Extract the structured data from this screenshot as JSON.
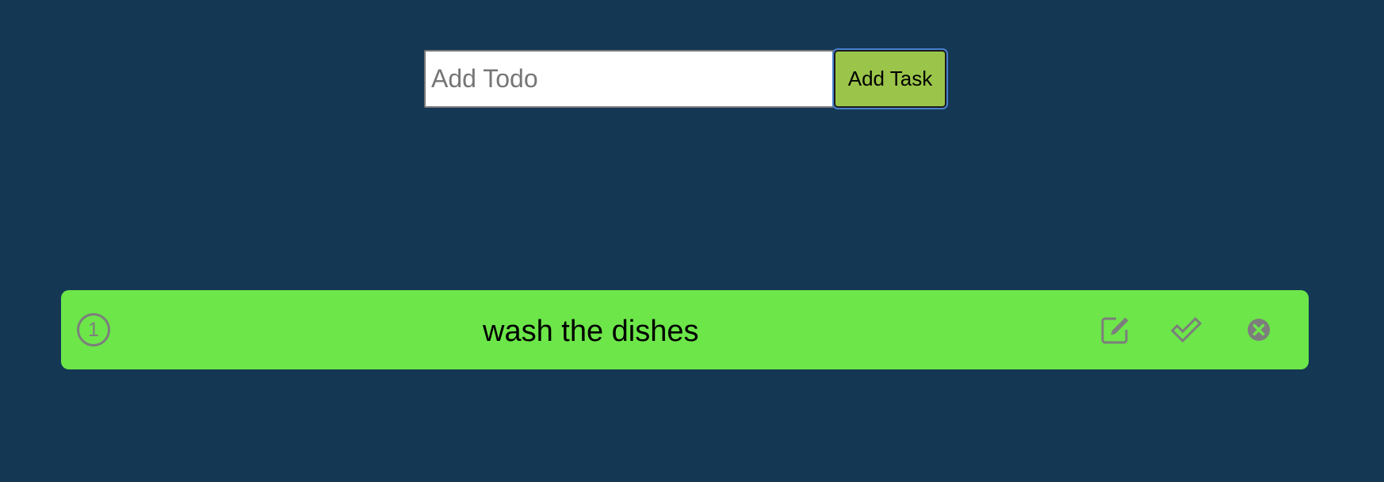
{
  "add_form": {
    "input_placeholder": "Add Todo",
    "input_value": "",
    "button_label": "Add Task"
  },
  "todos": [
    {
      "index": "1",
      "text": "wash the dishes",
      "icons": [
        "edit-icon",
        "check-icon",
        "close-circle-icon"
      ]
    }
  ],
  "colors": {
    "background": "#143754",
    "todo_item": "#6ce649",
    "add_button": "#9bc54a",
    "icon_gray": "#7d7d7d"
  }
}
